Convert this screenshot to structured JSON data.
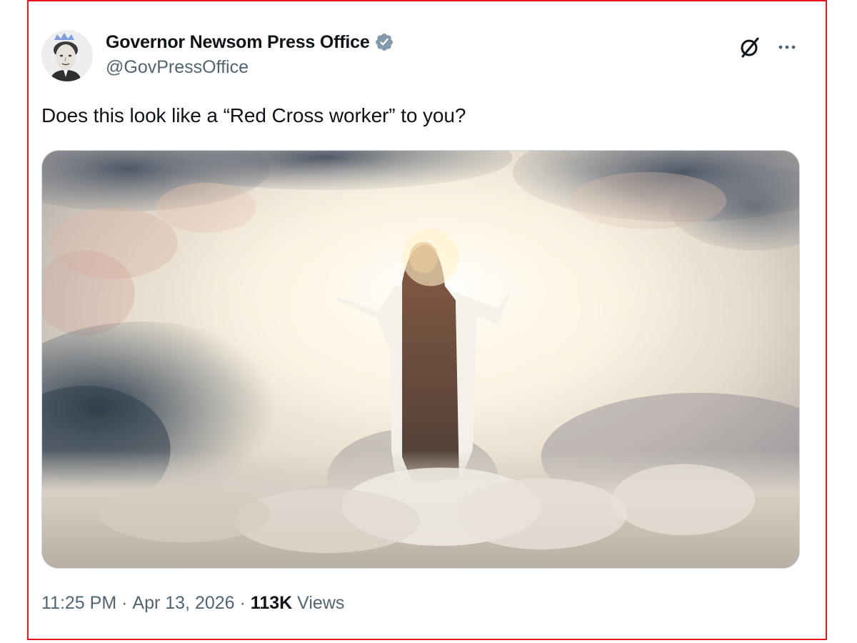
{
  "tweet": {
    "author": {
      "display_name": "Governor Newsom Press Office",
      "handle": "@GovPressOffice",
      "verified": true,
      "verified_color": "#829aab"
    },
    "text": "Does this look like a “Red Cross worker” to you?",
    "timestamp": {
      "time": "11:25 PM",
      "separator": "·",
      "date": "Apr 13, 2026"
    },
    "views": {
      "separator": "·",
      "count": "113K",
      "label": "Views"
    },
    "icons": {
      "grok": "grok-icon",
      "more": "more-options-icon",
      "verified": "verified-badge-icon"
    }
  },
  "colors": {
    "frame_border": "#e8141b",
    "text_primary": "#0f1419",
    "text_secondary": "#536471"
  }
}
